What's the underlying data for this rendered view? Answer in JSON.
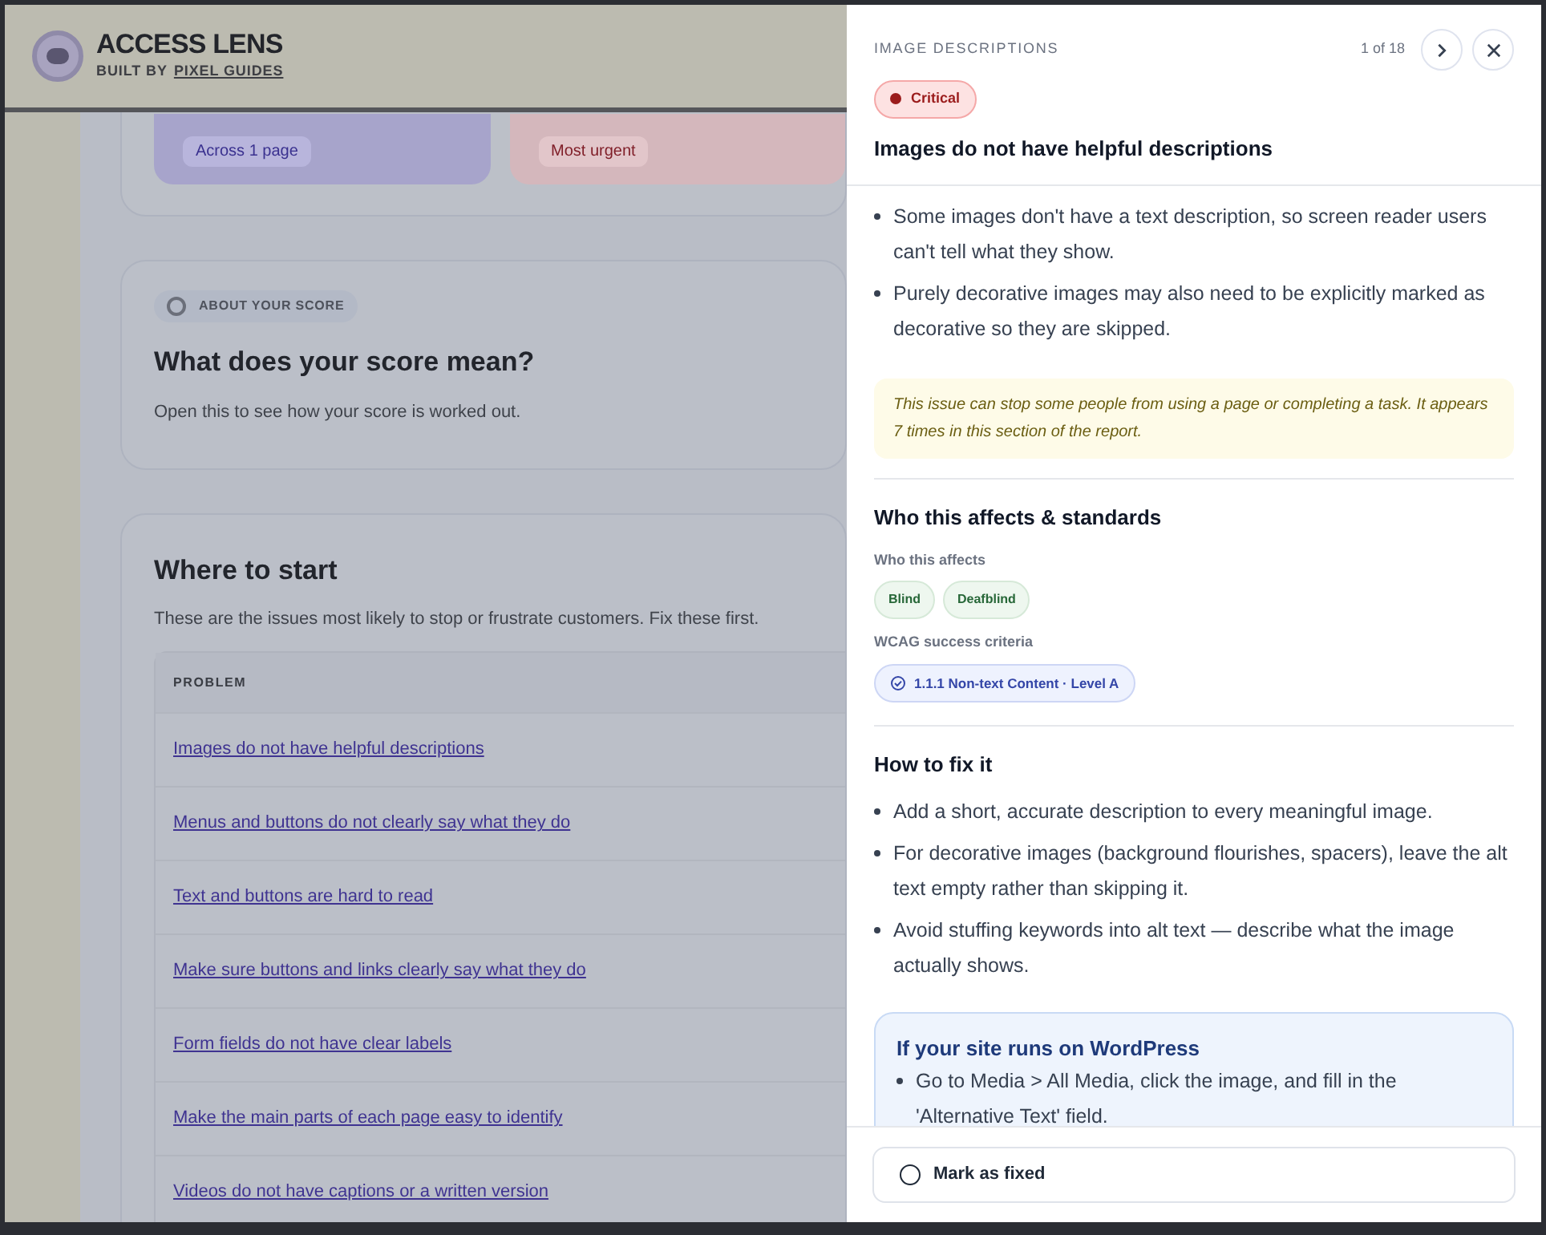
{
  "background_page": {
    "header": {
      "title": "ACCESS LENS",
      "byline_prefix": "BUILT BY",
      "byline_link": "PIXEL GUIDES"
    },
    "summary_cards": [
      {
        "kind": "scope",
        "tag": "Across 1 page"
      },
      {
        "kind": "urgent",
        "tag": "Most urgent"
      }
    ],
    "score_card": {
      "tag": "ABOUT YOUR SCORE",
      "title": "What does your score mean?",
      "description": "Open this to see how your score is worked out."
    },
    "where_to_start": {
      "title": "Where to start",
      "description": "These are the issues most likely to stop or frustrate customers. Fix these first.",
      "column_header": "PROBLEM",
      "rows": [
        "Images do not have helpful descriptions",
        "Menus and buttons do not clearly say what they do",
        "Text and buttons are hard to read",
        "Make sure buttons and links clearly say what they do",
        "Form fields do not have clear labels",
        "Make the main parts of each page easy to identify",
        "Videos do not have captions or a written version"
      ]
    }
  },
  "panel": {
    "category": "IMAGE DESCRIPTIONS",
    "position": "1 of 18",
    "severity": {
      "kind": "critical",
      "label": "Critical"
    },
    "title": "Images do not have helpful descriptions",
    "summary_points": [
      "Some images don't have a text description, so screen reader users can't tell what they show.",
      "Purely decorative images may also need to be explicitly marked as decorative so they are skipped."
    ],
    "notice": "This issue can stop some people from using a page or completing a task. It appears 7 times in this section of the report.",
    "affects": {
      "title": "Who this affects & standards",
      "groups_label": "Who this affects",
      "groups": [
        "Blind",
        "Deafblind"
      ],
      "criteria_label": "WCAG success criteria",
      "criteria": [
        "1.1.1 Non-text Content · Level A"
      ]
    },
    "fix": {
      "title": "How to fix it",
      "steps": [
        "Add a short, accurate description to every meaningful image.",
        "For decorative images (background flourishes, spacers), leave the alt text empty rather than skipping it.",
        "Avoid stuffing keywords into alt text — describe what the image actually shows."
      ],
      "platform_tip": {
        "title": "If your site runs on WordPress",
        "steps": [
          "Go to Media > All Media, click the image, and fill in the 'Alternative Text' field."
        ]
      }
    },
    "mark_fixed": {
      "label": "Mark as fixed",
      "checked": false
    }
  }
}
